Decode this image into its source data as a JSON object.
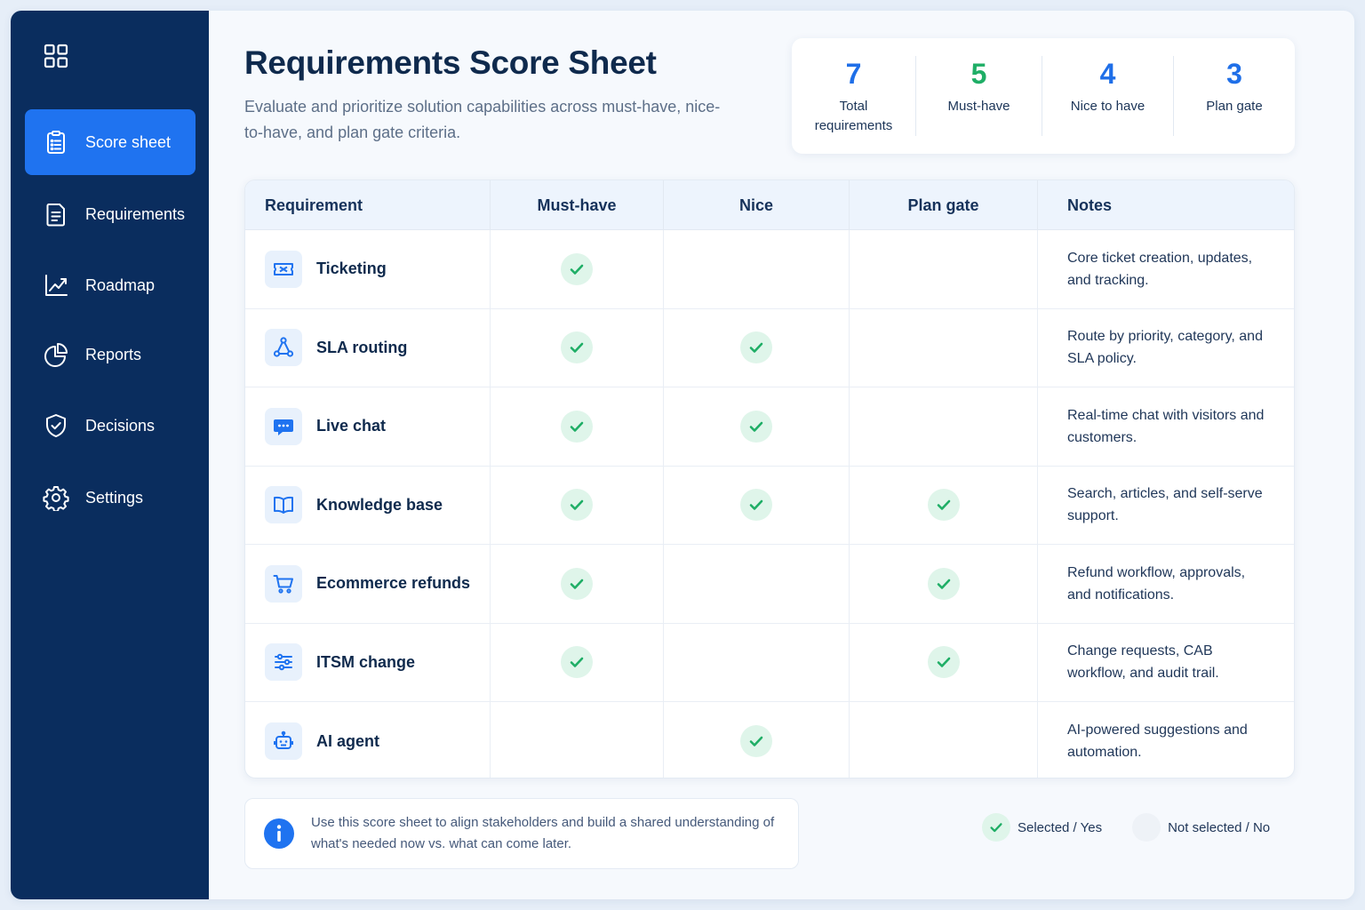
{
  "sidebar": {
    "logo_icon": "grid-icon",
    "items": [
      {
        "label": "Score sheet",
        "icon": "clipboard-icon",
        "active": true
      },
      {
        "label": "Requirements",
        "icon": "document-list-icon",
        "active": false
      },
      {
        "label": "Roadmap",
        "icon": "line-chart-icon",
        "active": false
      },
      {
        "label": "Reports",
        "icon": "pie-chart-icon",
        "active": false
      },
      {
        "label": "Decisions",
        "icon": "shield-check-icon",
        "active": false
      },
      {
        "label": "Settings",
        "icon": "gear-icon",
        "active": false
      }
    ]
  },
  "header": {
    "title": "Requirements Score Sheet",
    "subtitle": "Evaluate and prioritize solution capabilities across must-have, nice-to-have, and plan gate criteria."
  },
  "stats": [
    {
      "value": "7",
      "label": "Total requirements",
      "color": "#1f6fe8"
    },
    {
      "value": "5",
      "label": "Must-have",
      "color": "#1fae66"
    },
    {
      "value": "4",
      "label": "Nice to have",
      "color": "#1f6fe8"
    },
    {
      "value": "3",
      "label": "Plan gate",
      "color": "#1f6fe8"
    }
  ],
  "table": {
    "columns": [
      "Requirement",
      "Must-have",
      "Nice",
      "Plan gate",
      "Notes"
    ],
    "rows": [
      {
        "name": "Ticketing",
        "icon": "ticket-icon",
        "must_have": true,
        "nice": false,
        "plan_gate": false,
        "notes": "Core ticket creation, updates, and tracking."
      },
      {
        "name": "SLA routing",
        "icon": "routing-nodes-icon",
        "must_have": true,
        "nice": true,
        "plan_gate": false,
        "notes": "Route by priority, category, and SLA policy."
      },
      {
        "name": "Live chat",
        "icon": "chat-bubble-icon",
        "must_have": true,
        "nice": true,
        "plan_gate": false,
        "notes": "Real-time chat with visitors and customers."
      },
      {
        "name": "Knowledge base",
        "icon": "open-book-icon",
        "must_have": true,
        "nice": true,
        "plan_gate": true,
        "notes": "Search, articles, and self-serve support."
      },
      {
        "name": "Ecommerce refunds",
        "icon": "shopping-cart-icon",
        "must_have": true,
        "nice": false,
        "plan_gate": true,
        "notes": "Refund workflow, approvals, and notifications."
      },
      {
        "name": "ITSM change",
        "icon": "sliders-icon",
        "must_have": true,
        "nice": false,
        "plan_gate": true,
        "notes": "Change requests, CAB workflow, and audit trail."
      },
      {
        "name": "AI agent",
        "icon": "robot-icon",
        "must_have": false,
        "nice": true,
        "plan_gate": false,
        "notes": "AI-powered suggestions and automation."
      }
    ]
  },
  "info": {
    "icon": "info-icon",
    "text": "Use this score sheet to align stakeholders and build a shared understanding of what's needed now vs. what can come later."
  },
  "legend": {
    "selected": "Selected / Yes",
    "not_selected": "Not selected / No"
  },
  "colors": {
    "sidebar_bg": "#0a2d5e",
    "accent": "#1f73f0",
    "check_green": "#1fae66",
    "check_bg": "#dff5ea"
  }
}
